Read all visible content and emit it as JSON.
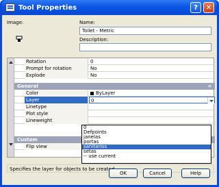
{
  "window": {
    "title": "Tool Properties",
    "help_glyph": "?",
    "close_glyph": "✕",
    "title_icon": "tool-properties-icon"
  },
  "header": {
    "image_label": "Image:",
    "name_label": "Name:",
    "name_value": "Toilet - Metric",
    "description_label": "Description:",
    "description_value": ""
  },
  "properties": {
    "top_rows": [
      {
        "key": "Rotation",
        "value": "0"
      },
      {
        "key": "Prompt for rotation",
        "value": "No"
      },
      {
        "key": "Explode",
        "value": "No"
      }
    ],
    "general_section": "General",
    "general_rows": [
      {
        "key": "Color",
        "value": "ByLayer"
      },
      {
        "key": "Layer",
        "value": "0"
      },
      {
        "key": "Linetype",
        "value": ""
      },
      {
        "key": "Plot style",
        "value": ""
      },
      {
        "key": "Lineweight",
        "value": ""
      }
    ],
    "custom_section": "Custom",
    "custom_rows": [
      {
        "key": "Flip view",
        "value": ""
      }
    ]
  },
  "layer_dropdown": {
    "options": [
      "0",
      "Defpoints",
      "janelas",
      "portas",
      "sanitarios",
      "setas",
      "-- use current"
    ],
    "highlighted": "sanitarios"
  },
  "status_help": "Specifies the layer for objects to be created",
  "buttons": {
    "ok": "OK",
    "cancel": "Cancel",
    "help": "Help"
  },
  "colors": {
    "title_bar": "#0b55e5",
    "selection": "#316ac5",
    "section_header": "#9da3b8",
    "dialog_bg": "#ece9d8"
  }
}
